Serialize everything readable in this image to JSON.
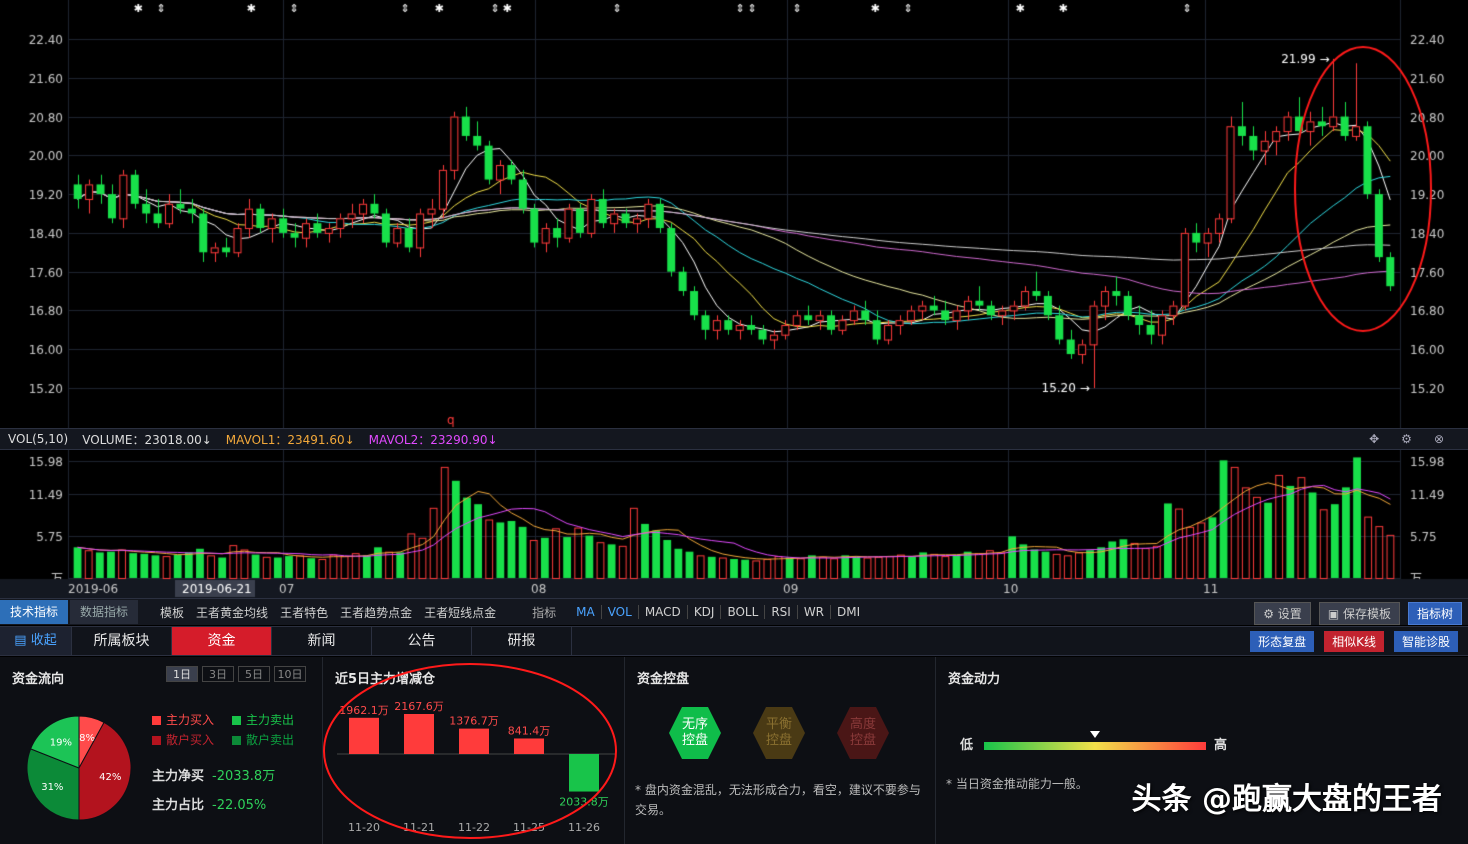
{
  "colors": {
    "up": "#ff3b3b",
    "down": "#18e04a",
    "grid": "#1e2430",
    "axis_text": "#c8c8c8",
    "ma5": "#ffffff",
    "ma10": "#f2e04a",
    "ma20": "#e24aff",
    "ma30": "#2fd8e0",
    "ma60": "#d06ad0",
    "accent_blue": "#2d6fb8",
    "accent_red": "#d51c2a"
  },
  "price_axis": {
    "ticks": [
      "22.40",
      "21.60",
      "20.80",
      "20.00",
      "19.20",
      "18.40",
      "17.60",
      "16.80",
      "16.00",
      "15.20"
    ]
  },
  "time_axis": {
    "labels": [
      "2019-06",
      "07",
      "08",
      "09",
      "10",
      "11"
    ],
    "cursor_date": "2019-06-21"
  },
  "chart_data": {
    "type": "candlestick",
    "ylim": [
      15.2,
      22.4
    ],
    "annotations": {
      "high": "21.99",
      "low": "15.20",
      "marker": "q"
    },
    "candles": [
      [
        19.4,
        19.6,
        18.9,
        19.1
      ],
      [
        19.1,
        19.5,
        18.8,
        19.4
      ],
      [
        19.4,
        19.6,
        19.0,
        19.2
      ],
      [
        19.2,
        19.4,
        18.6,
        18.7
      ],
      [
        18.7,
        19.7,
        18.5,
        19.6
      ],
      [
        19.6,
        19.7,
        18.9,
        19.0
      ],
      [
        19.0,
        19.3,
        18.6,
        18.8
      ],
      [
        18.8,
        19.1,
        18.5,
        18.6
      ],
      [
        18.6,
        19.2,
        18.5,
        19.0
      ],
      [
        19.0,
        19.3,
        18.8,
        18.9
      ],
      [
        18.9,
        19.1,
        18.6,
        18.8
      ],
      [
        18.8,
        18.9,
        17.8,
        18.0
      ],
      [
        18.0,
        18.2,
        17.8,
        18.1
      ],
      [
        18.1,
        18.3,
        17.9,
        18.0
      ],
      [
        18.0,
        18.6,
        17.9,
        18.5
      ],
      [
        18.5,
        19.1,
        18.3,
        18.9
      ],
      [
        18.9,
        19.0,
        18.4,
        18.5
      ],
      [
        18.5,
        18.8,
        18.2,
        18.7
      ],
      [
        18.7,
        18.9,
        18.3,
        18.4
      ],
      [
        18.4,
        18.6,
        18.1,
        18.3
      ],
      [
        18.3,
        18.7,
        18.1,
        18.6
      ],
      [
        18.6,
        18.8,
        18.3,
        18.4
      ],
      [
        18.4,
        18.6,
        18.2,
        18.5
      ],
      [
        18.5,
        18.8,
        18.3,
        18.7
      ],
      [
        18.7,
        19.0,
        18.5,
        18.8
      ],
      [
        18.8,
        19.1,
        18.6,
        19.0
      ],
      [
        19.0,
        19.2,
        18.7,
        18.8
      ],
      [
        18.8,
        18.9,
        18.1,
        18.2
      ],
      [
        18.2,
        18.6,
        18.1,
        18.5
      ],
      [
        18.5,
        18.7,
        18.0,
        18.1
      ],
      [
        18.1,
        18.9,
        17.9,
        18.8
      ],
      [
        18.8,
        19.1,
        18.5,
        18.9
      ],
      [
        18.9,
        19.8,
        18.7,
        19.7
      ],
      [
        19.7,
        20.9,
        19.5,
        20.8
      ],
      [
        20.8,
        21.0,
        20.3,
        20.4
      ],
      [
        20.4,
        20.7,
        20.1,
        20.2
      ],
      [
        20.2,
        20.3,
        19.4,
        19.5
      ],
      [
        19.5,
        19.9,
        19.2,
        19.8
      ],
      [
        19.8,
        19.9,
        19.4,
        19.5
      ],
      [
        19.5,
        19.7,
        18.8,
        18.9
      ],
      [
        18.9,
        19.0,
        18.1,
        18.2
      ],
      [
        18.2,
        18.6,
        18.0,
        18.5
      ],
      [
        18.5,
        18.7,
        18.1,
        18.3
      ],
      [
        18.3,
        19.0,
        18.2,
        18.9
      ],
      [
        18.9,
        19.0,
        18.3,
        18.4
      ],
      [
        18.4,
        19.2,
        18.3,
        19.1
      ],
      [
        19.1,
        19.3,
        18.5,
        18.6
      ],
      [
        18.6,
        18.9,
        18.4,
        18.8
      ],
      [
        18.8,
        18.9,
        18.5,
        18.6
      ],
      [
        18.6,
        18.8,
        18.4,
        18.7
      ],
      [
        18.7,
        19.1,
        18.5,
        19.0
      ],
      [
        19.0,
        19.1,
        18.4,
        18.5
      ],
      [
        18.5,
        18.6,
        17.5,
        17.6
      ],
      [
        17.6,
        17.7,
        17.1,
        17.2
      ],
      [
        17.2,
        17.3,
        16.6,
        16.7
      ],
      [
        16.7,
        16.8,
        16.2,
        16.4
      ],
      [
        16.4,
        16.7,
        16.2,
        16.6
      ],
      [
        16.6,
        16.7,
        16.3,
        16.4
      ],
      [
        16.4,
        16.6,
        16.2,
        16.5
      ],
      [
        16.5,
        16.7,
        16.3,
        16.4
      ],
      [
        16.4,
        16.5,
        16.1,
        16.2
      ],
      [
        16.2,
        16.4,
        16.0,
        16.3
      ],
      [
        16.3,
        16.6,
        16.2,
        16.5
      ],
      [
        16.5,
        16.8,
        16.4,
        16.7
      ],
      [
        16.7,
        16.9,
        16.5,
        16.6
      ],
      [
        16.6,
        16.8,
        16.4,
        16.7
      ],
      [
        16.7,
        16.8,
        16.3,
        16.4
      ],
      [
        16.4,
        16.7,
        16.3,
        16.6
      ],
      [
        16.6,
        16.9,
        16.5,
        16.8
      ],
      [
        16.8,
        17.0,
        16.5,
        16.6
      ],
      [
        16.6,
        16.8,
        16.1,
        16.2
      ],
      [
        16.2,
        16.6,
        16.1,
        16.5
      ],
      [
        16.5,
        16.7,
        16.3,
        16.6
      ],
      [
        16.6,
        16.9,
        16.5,
        16.8
      ],
      [
        16.8,
        17.0,
        16.6,
        16.9
      ],
      [
        16.9,
        17.1,
        16.7,
        16.8
      ],
      [
        16.8,
        17.0,
        16.5,
        16.6
      ],
      [
        16.6,
        16.9,
        16.4,
        16.8
      ],
      [
        16.8,
        17.1,
        16.6,
        17.0
      ],
      [
        17.0,
        17.3,
        16.8,
        16.9
      ],
      [
        16.9,
        17.0,
        16.6,
        16.7
      ],
      [
        16.7,
        16.9,
        16.5,
        16.8
      ],
      [
        16.8,
        17.0,
        16.6,
        16.9
      ],
      [
        16.9,
        17.3,
        16.8,
        17.2
      ],
      [
        17.2,
        17.6,
        17.0,
        17.1
      ],
      [
        17.1,
        17.2,
        16.6,
        16.7
      ],
      [
        16.7,
        16.9,
        16.1,
        16.2
      ],
      [
        16.2,
        16.4,
        15.8,
        15.9
      ],
      [
        15.9,
        16.2,
        15.7,
        16.1
      ],
      [
        16.1,
        17.0,
        15.2,
        16.9
      ],
      [
        16.9,
        17.3,
        16.6,
        17.2
      ],
      [
        17.2,
        17.5,
        16.9,
        17.1
      ],
      [
        17.1,
        17.2,
        16.6,
        16.7
      ],
      [
        16.7,
        16.9,
        16.3,
        16.5
      ],
      [
        16.5,
        16.8,
        16.1,
        16.3
      ],
      [
        16.3,
        16.8,
        16.1,
        16.7
      ],
      [
        16.7,
        17.0,
        16.5,
        16.9
      ],
      [
        16.9,
        18.5,
        16.8,
        18.4
      ],
      [
        18.4,
        18.6,
        18.0,
        18.2
      ],
      [
        18.2,
        18.5,
        17.9,
        18.4
      ],
      [
        18.4,
        18.8,
        18.2,
        18.7
      ],
      [
        18.7,
        20.8,
        18.6,
        20.6
      ],
      [
        20.6,
        21.1,
        20.2,
        20.4
      ],
      [
        20.4,
        20.6,
        19.9,
        20.1
      ],
      [
        20.1,
        20.5,
        19.8,
        20.3
      ],
      [
        20.3,
        20.6,
        20.0,
        20.5
      ],
      [
        20.5,
        20.9,
        20.3,
        20.8
      ],
      [
        20.8,
        21.2,
        20.4,
        20.5
      ],
      [
        20.5,
        20.9,
        20.2,
        20.7
      ],
      [
        20.7,
        21.0,
        20.4,
        20.6
      ],
      [
        20.6,
        21.99,
        20.5,
        20.8
      ],
      [
        20.8,
        21.1,
        20.3,
        20.4
      ],
      [
        20.4,
        21.9,
        20.3,
        20.6
      ],
      [
        20.6,
        20.7,
        19.1,
        19.2
      ],
      [
        19.2,
        19.3,
        17.8,
        17.9
      ],
      [
        17.9,
        18.0,
        17.2,
        17.3
      ]
    ]
  },
  "vol_header": {
    "title": "VOL(5,10)",
    "volume": "VOLUME：23018.00↓",
    "mavol1": "MAVOL1：23491.60↓",
    "mavol2": "MAVOL2：23290.90↓"
  },
  "vol_axis": {
    "ticks": [
      "15.98",
      "11.49",
      "5.75",
      "万"
    ],
    "top": "17.24"
  },
  "vol_data": {
    "values": [
      4.2,
      3.8,
      3.5,
      3.6,
      3.9,
      3.4,
      3.3,
      3.1,
      3.0,
      3.2,
      3.5,
      4.0,
      3.1,
      2.8,
      4.5,
      3.9,
      3.2,
      2.9,
      2.8,
      3.0,
      3.1,
      2.7,
      2.6,
      3.2,
      3.0,
      3.4,
      3.1,
      4.2,
      3.6,
      3.5,
      6.1,
      5.5,
      9.6,
      15.2,
      13.3,
      11.0,
      10.1,
      8.0,
      7.6,
      7.8,
      7.0,
      5.2,
      5.5,
      6.8,
      5.6,
      6.9,
      5.8,
      4.9,
      4.6,
      4.4,
      9.6,
      7.4,
      6.5,
      5.2,
      4.0,
      3.6,
      3.1,
      2.9,
      2.8,
      2.6,
      2.5,
      2.4,
      2.6,
      3.0,
      2.8,
      2.7,
      3.1,
      2.9,
      2.7,
      3.1,
      3.0,
      2.8,
      2.9,
      3.0,
      3.2,
      2.9,
      3.5,
      3.3,
      3.0,
      3.2,
      3.6,
      3.4,
      3.8,
      3.5,
      5.7,
      4.6,
      3.9,
      3.6,
      3.3,
      3.1,
      3.5,
      3.8,
      4.2,
      5.0,
      5.3,
      4.8,
      4.1,
      4.4,
      10.2,
      9.5,
      7.0,
      7.6,
      8.3,
      16.1,
      15.2,
      12.4,
      11.1,
      10.3,
      14.1,
      12.6,
      13.8,
      11.7,
      9.4,
      10.1,
      12.4,
      16.5,
      8.4,
      7.1,
      5.9
    ]
  },
  "indicator_bar": {
    "tab_active": "技术指标",
    "tab_other": "数据指标",
    "items": [
      "模板",
      "王者黄金均线",
      "王者特色",
      "王者趋势点金",
      "王者短线点金"
    ],
    "label": "指标",
    "indicators": [
      "MA",
      "VOL",
      "MACD",
      "KDJ",
      "BOLL",
      "RSI",
      "WR",
      "DMI"
    ],
    "settings": "设置",
    "save_template": "保存模板",
    "tree": "指标树"
  },
  "nav": {
    "collapse": "收起",
    "tabs": [
      "所属板块",
      "资金",
      "新闻",
      "公告",
      "研报"
    ],
    "active_tab": "资金",
    "right": [
      "形态复盘",
      "相似K线",
      "智能诊股"
    ]
  },
  "fund_flow": {
    "title": "资金流向",
    "periods": [
      "1日",
      "3日",
      "5日",
      "10日"
    ],
    "legend": [
      {
        "label": "主力买入",
        "color": "#ff3b3b"
      },
      {
        "label": "主力卖出",
        "color": "#18c44a"
      },
      {
        "label": "散户买入",
        "color": "#b3131e"
      },
      {
        "label": "散户卖出",
        "color": "#0c8a38"
      }
    ],
    "pie": [
      {
        "label": "8%",
        "value": 8,
        "color": "#ff4b4b"
      },
      {
        "label": "42%",
        "value": 42,
        "color": "#b3131e"
      },
      {
        "label": "31%",
        "value": 31,
        "color": "#0c8a38"
      },
      {
        "label": "19%",
        "value": 19,
        "color": "#1cc456"
      }
    ],
    "net_label": "主力净买",
    "net_value": "-2033.8万",
    "ratio_label": "主力占比",
    "ratio_value": "-22.05%"
  },
  "five_day": {
    "title": "近5日主力增减仓",
    "bars": [
      {
        "date": "11-20",
        "value": 1962.1,
        "label": "1962.1万"
      },
      {
        "date": "11-21",
        "value": 2167.6,
        "label": "2167.6万"
      },
      {
        "date": "11-22",
        "value": 1376.7,
        "label": "1376.7万"
      },
      {
        "date": "11-25",
        "value": 841.4,
        "label": "841.4万"
      },
      {
        "date": "11-26",
        "value": -2033.8,
        "label": "2033.8万"
      }
    ]
  },
  "control": {
    "title": "资金控盘",
    "hexes": [
      {
        "text": "无序控盘",
        "bg": "#0fbd4a",
        "fg": "#ffffff"
      },
      {
        "text": "平衡控盘",
        "bg": "#4a3a14",
        "fg": "#8a7030"
      },
      {
        "text": "高度控盘",
        "bg": "#4a1616",
        "fg": "#8a3a3a"
      }
    ],
    "note": "* 盘内资金混乱，无法形成合力，看空，建议不要参与交易。"
  },
  "power": {
    "title": "资金动力",
    "low": "低",
    "high": "高",
    "note": "* 当日资金推动能力一般。"
  },
  "watermark": "头条 @跑赢大盘的王者"
}
